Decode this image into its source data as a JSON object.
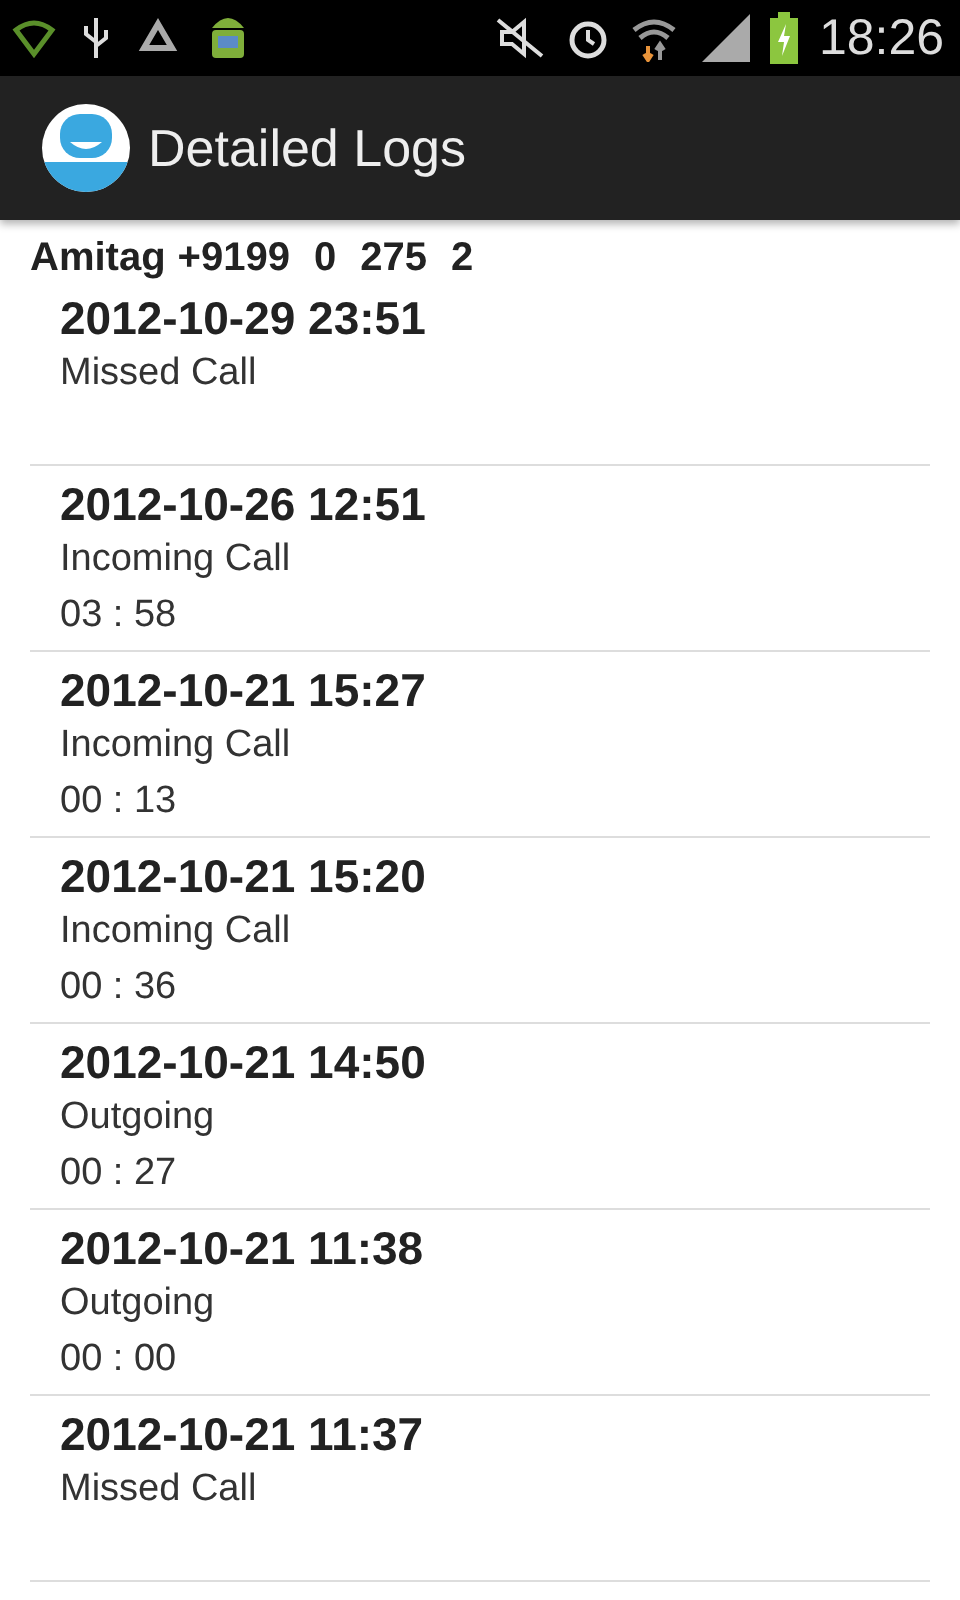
{
  "status_bar": {
    "time": "18:26"
  },
  "action_bar": {
    "title": "Detailed Logs"
  },
  "header": [
    "Amitag",
    "+9199",
    "0",
    "275",
    "2"
  ],
  "logs": [
    {
      "datetime": "2012-10-29 23:51",
      "type": "Missed Call"
    },
    {
      "datetime": "2012-10-26 12:51",
      "type": "Incoming Call",
      "duration": "03 : 58"
    },
    {
      "datetime": "2012-10-21 15:27",
      "type": "Incoming Call",
      "duration": "00 : 13"
    },
    {
      "datetime": "2012-10-21 15:20",
      "type": "Incoming Call",
      "duration": "00 : 36"
    },
    {
      "datetime": "2012-10-21 14:50",
      "type": "Outgoing",
      "duration": "00 : 27"
    },
    {
      "datetime": "2012-10-21 11:38",
      "type": "Outgoing",
      "duration": "00 : 00"
    },
    {
      "datetime": "2012-10-21 11:37",
      "type": "Missed Call"
    }
  ]
}
